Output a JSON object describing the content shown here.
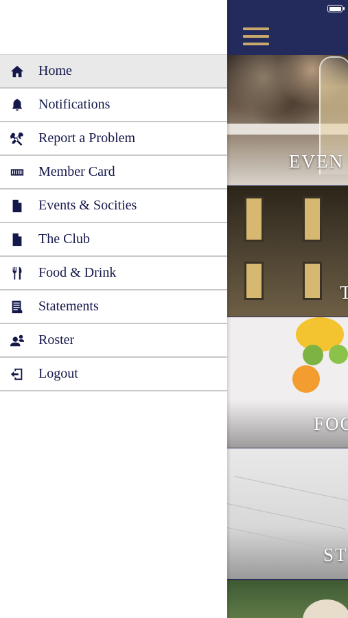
{
  "menu": {
    "items": [
      {
        "label": "Home",
        "icon": "home-icon",
        "active": true
      },
      {
        "label": "Notifications",
        "icon": "bell-icon"
      },
      {
        "label": "Report a Problem",
        "icon": "tools-icon"
      },
      {
        "label": "Member Card",
        "icon": "card-icon"
      },
      {
        "label": "Events & Socities",
        "icon": "document-icon"
      },
      {
        "label": "The Club",
        "icon": "document-icon"
      },
      {
        "label": "Food & Drink",
        "icon": "utensils-icon"
      },
      {
        "label": "Statements",
        "icon": "receipt-icon"
      },
      {
        "label": "Roster",
        "icon": "people-icon"
      },
      {
        "label": "Logout",
        "icon": "logout-icon"
      }
    ]
  },
  "content": {
    "tiles": [
      {
        "label": "EVEN"
      },
      {
        "label": "T"
      },
      {
        "label": "FOO"
      },
      {
        "label": "ST"
      }
    ]
  },
  "colors": {
    "navy": "#232a5c",
    "gold": "#c9a86b",
    "menu_text": "#14174a",
    "active_bg": "#e9e9e9"
  }
}
